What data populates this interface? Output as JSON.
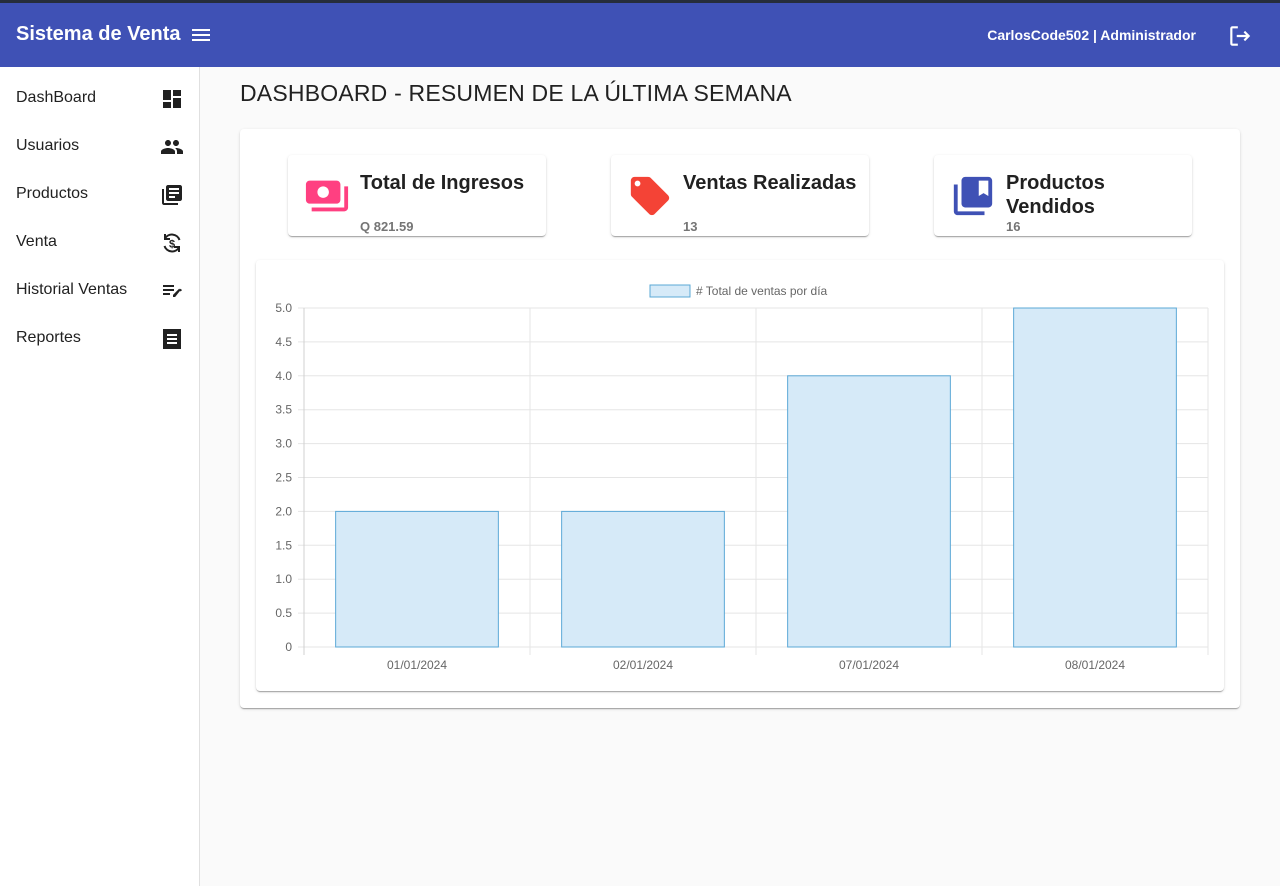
{
  "app": {
    "title": "Sistema de Venta",
    "user": "CarlosCode502 | Administrador"
  },
  "sidebar": {
    "items": [
      {
        "label": "DashBoard",
        "icon": "dashboard-icon"
      },
      {
        "label": "Usuarios",
        "icon": "people-icon"
      },
      {
        "label": "Productos",
        "icon": "library-books-icon"
      },
      {
        "label": "Venta",
        "icon": "currency-exchange-icon"
      },
      {
        "label": "Historial Ventas",
        "icon": "edit-note-icon"
      },
      {
        "label": "Reportes",
        "icon": "receipt-icon"
      }
    ]
  },
  "main": {
    "title": "DASHBOARD - RESUMEN DE LA ÚLTIMA SEMANA",
    "stats": [
      {
        "title": "Total de Ingresos",
        "value": "Q 821.59",
        "icon": "payments-icon",
        "color": "#ff4081"
      },
      {
        "title": "Ventas Realizadas",
        "value": "13",
        "icon": "sell-tag-icon",
        "color": "#f44336"
      },
      {
        "title": "Productos Vendidos",
        "value": "16",
        "icon": "collections-bookmark-icon",
        "color": "#3f51b5"
      }
    ]
  },
  "colors": {
    "toolbar": "#3f51b5",
    "bar_fill": "#d6eaf8",
    "bar_border": "#5ba8d6"
  },
  "chart_data": {
    "type": "bar",
    "categories": [
      "01/01/2024",
      "02/01/2024",
      "07/01/2024",
      "08/01/2024"
    ],
    "series": [
      {
        "name": "# Total de ventas por día",
        "values": [
          2,
          2,
          4,
          5
        ]
      }
    ],
    "ylim": [
      0,
      5
    ],
    "yticks": [
      "0",
      "0.5",
      "1.0",
      "1.5",
      "2.0",
      "2.5",
      "3.0",
      "3.5",
      "4.0",
      "4.5",
      "5.0"
    ],
    "legend": "top",
    "grid": true
  }
}
